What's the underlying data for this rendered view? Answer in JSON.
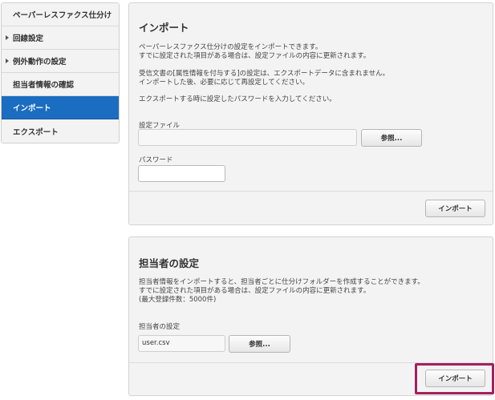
{
  "sidebar": {
    "items": [
      {
        "label": "ペーパーレスファクス仕分け",
        "arrow": false
      },
      {
        "label": "回線設定",
        "arrow": true
      },
      {
        "label": "例外動作の設定",
        "arrow": true
      },
      {
        "label": "担当者情報の確認",
        "arrow": false
      },
      {
        "label": "インポート",
        "arrow": false,
        "active": true
      },
      {
        "label": "エクスポート",
        "arrow": false
      }
    ]
  },
  "import_panel": {
    "title": "インポート",
    "desc_line1": "ペーパーレスファクス仕分けの設定をインポートできます。",
    "desc_line2": "すでに設定された項目がある場合は、設定ファイルの内容に更新されます。",
    "desc_line3": "受信文書の[属性情報を付与する]の設定は、エクスポートデータに含まれません。",
    "desc_line4": "インポートした後、必要に応じて再設定してください。",
    "desc_line5": "エクスポートする時に設定したパスワードを入力してください。",
    "file_label": "設定ファイル",
    "file_value": "",
    "browse_label": "参照...",
    "password_label": "パスワード",
    "password_value": "",
    "import_button": "インポート"
  },
  "staff_panel": {
    "title": "担当者の設定",
    "desc_line1": "担当者情報をインポートすると、担当者ごとに仕分けフォルダーを作成することができます。",
    "desc_line2": "すでに設定された項目がある場合は、設定ファイルの内容に更新されます。",
    "desc_line3": "(最大登録件数：5000件)",
    "file_label": "担当者の設定",
    "file_value": "user.csv",
    "browse_label": "参照...",
    "import_button": "インポート"
  }
}
